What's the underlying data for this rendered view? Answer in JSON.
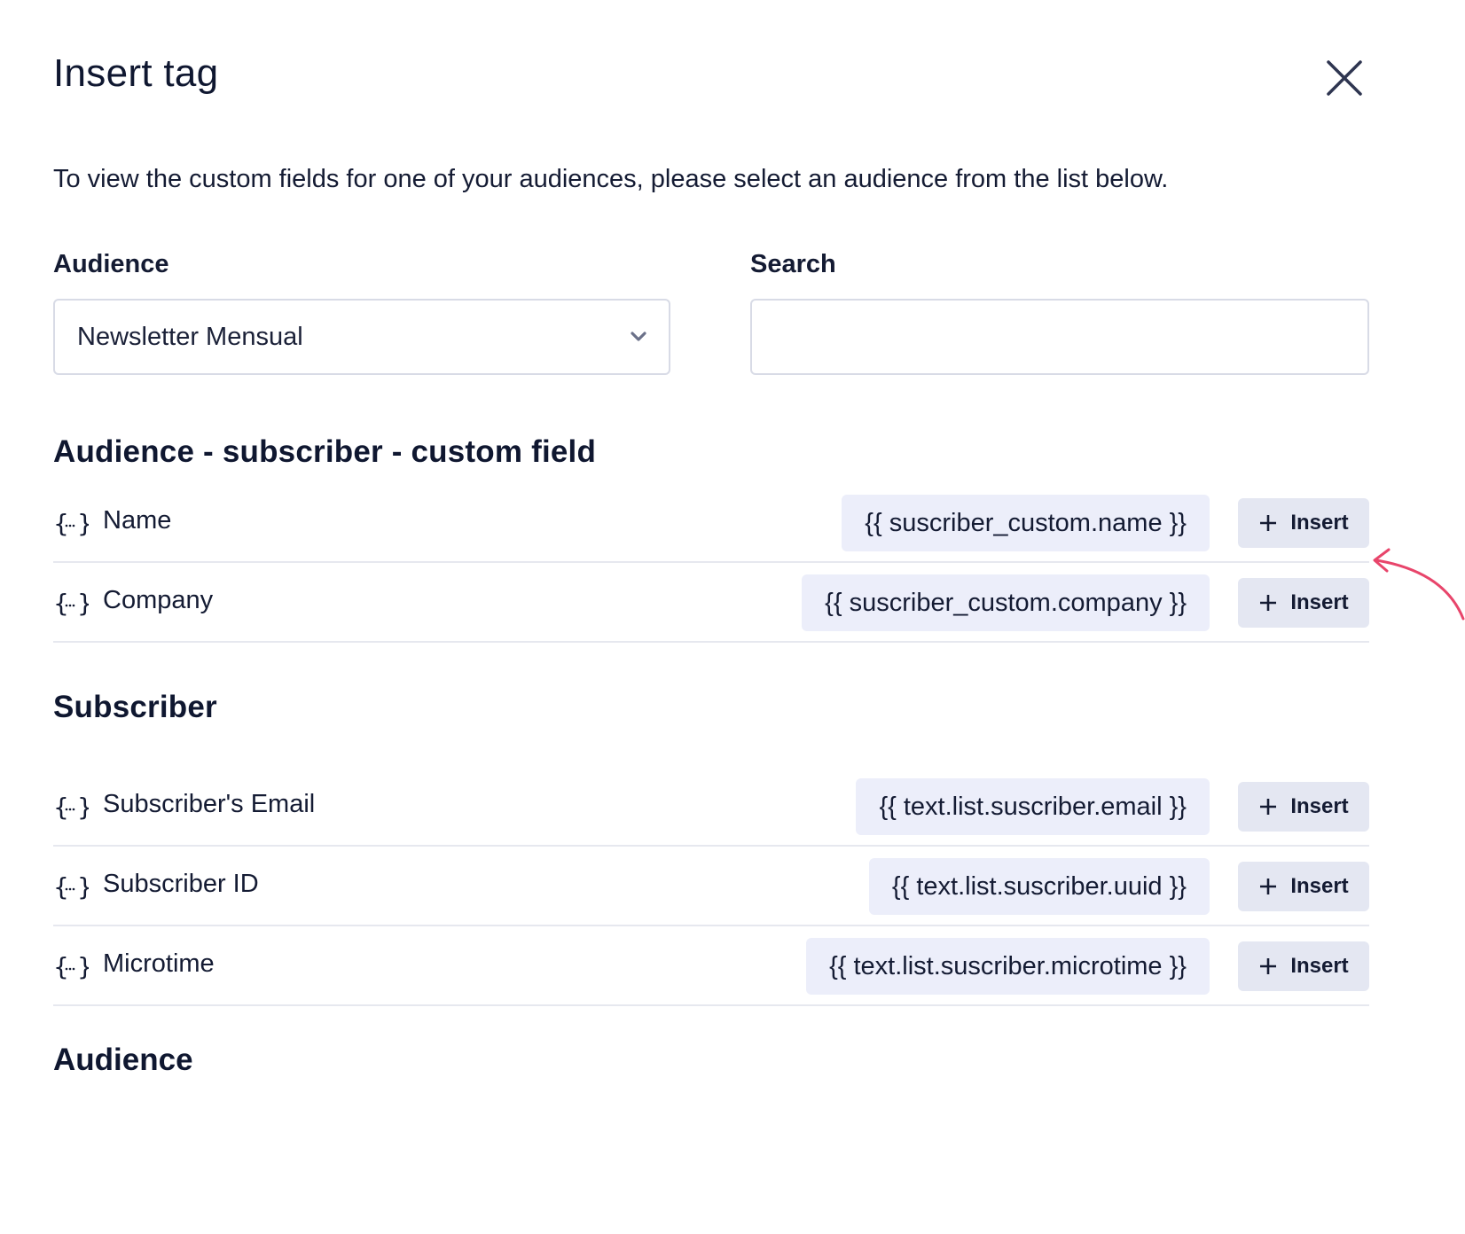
{
  "modal": {
    "title": "Insert tag",
    "intro": "To view the custom fields for one of your audiences, please select an audience from the list below."
  },
  "filters": {
    "audience_label": "Audience",
    "audience_value": "Newsletter Mensual",
    "search_label": "Search",
    "search_value": ""
  },
  "insert_label": "Insert",
  "sections": [
    {
      "title": "Audience - subscriber - custom field",
      "rows": [
        {
          "name": "Name",
          "tag": "{{ suscriber_custom.name }}"
        },
        {
          "name": "Company",
          "tag": "{{ suscriber_custom.company }}"
        }
      ]
    },
    {
      "title": "Subscriber",
      "rows": [
        {
          "name": "Subscriber's Email",
          "tag": "{{ text.list.suscriber.email }}"
        },
        {
          "name": "Subscriber ID",
          "tag": "{{ text.list.suscriber.uuid }}"
        },
        {
          "name": "Microtime",
          "tag": "{{ text.list.suscriber.microtime }}"
        }
      ]
    },
    {
      "title": "Audience",
      "rows": []
    }
  ],
  "icons": {
    "close": "close-icon",
    "chevron": "chevron-down-icon",
    "field": "curly-braces-icon",
    "plus": "plus-icon",
    "annotation": "arrow-annotation"
  },
  "colors": {
    "text": "#0f1730",
    "tag_bg": "#eceefa",
    "button_bg": "#e4e7f2",
    "border": "#d8dbe6",
    "annotation_arrow": "#e8456b"
  }
}
